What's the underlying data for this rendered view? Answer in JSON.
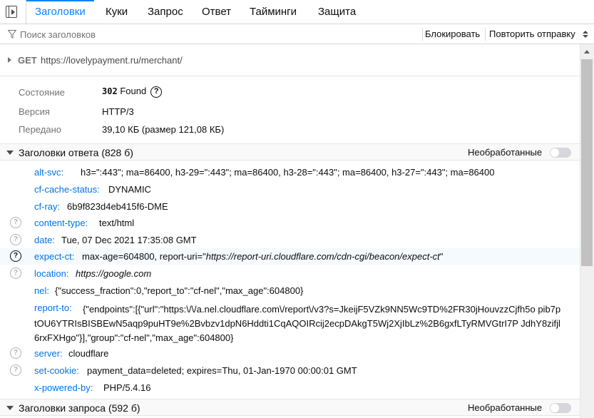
{
  "tabs": [
    {
      "label": "Заголовки"
    },
    {
      "label": "Куки"
    },
    {
      "label": "Запрос"
    },
    {
      "label": "Ответ"
    },
    {
      "label": "Тайминги"
    },
    {
      "label": "Защита"
    }
  ],
  "filter": {
    "placeholder": "Поиск заголовков",
    "block_label": "Блокировать",
    "resend_label": "Повторить отправку"
  },
  "request": {
    "method": "GET",
    "url": "https://lovelypayment.ru/merchant/"
  },
  "summary": {
    "status_label": "Состояние",
    "status_code": "302",
    "status_text": "Found",
    "version_label": "Версия",
    "version_value": "HTTP/3",
    "transferred_label": "Передано",
    "transferred_value": "39,10 КБ (размер 121,08 КБ)"
  },
  "response_section": {
    "title": "Заголовки ответа (828 б)",
    "raw_label": "Необработанные"
  },
  "request_section": {
    "title": "Заголовки запроса (592 б)",
    "raw_label": "Необработанные"
  },
  "headers": [
    {
      "name": "alt-svc:",
      "value": "h3=\":443\"; ma=86400, h3-29=\":443\"; ma=86400, h3-28=\":443\"; ma=86400, h3-27=\":443\"; ma=86400"
    },
    {
      "name": "cf-cache-status:",
      "value": "DYNAMIC"
    },
    {
      "name": "cf-ray:",
      "value": "6b9f823d4eb415f6-DME"
    },
    {
      "name": "content-type:",
      "value": "text/html"
    },
    {
      "name": "date:",
      "value": "Tue, 07 Dec 2021 17:35:08 GMT"
    },
    {
      "name": "expect-ct:",
      "value_prefix": "max-age=604800, report-uri=\"",
      "value_link": "https://report-uri.cloudflare.com/cdn-cgi/beacon/expect-ct",
      "value_suffix": "\""
    },
    {
      "name": "location:",
      "value": "https://google.com"
    },
    {
      "name": "nel:",
      "value": "{\"success_fraction\":0,\"report_to\":\"cf-nel\",\"max_age\":604800}"
    },
    {
      "name": "report-to:",
      "value": "{\"endpoints\":[{\"url\":\"https:\\/\\/a.nel.cloudflare.com\\/report\\/v3?s=JkeijF5VZk9NN5Wc9TD%2FR30jHouvzzCjfh5o pib7ptOU6YTRIsBISBEwN5aqp9puHT9e%2Bvbzv1dpN6Hddti1CqAQOIRcij2ecpDAkgT5Wj2XjIbLz%2B6gxfLTyRMVGtrI7P JdhY8zifjl6rxFXHgo\"}],\"group\":\"cf-nel\",\"max_age\":604800}"
    },
    {
      "name": "server:",
      "value": "cloudflare"
    },
    {
      "name": "set-cookie:",
      "value": "payment_data=deleted; expires=Thu, 01-Jan-1970 00:00:01 GMT"
    },
    {
      "name": "x-powered-by:",
      "value": "PHP/5.4.16"
    }
  ]
}
